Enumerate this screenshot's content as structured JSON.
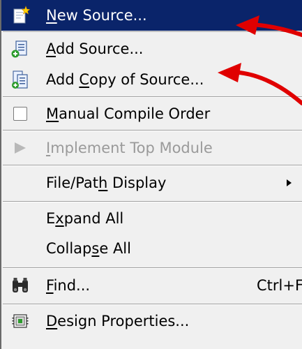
{
  "menu": {
    "items": [
      {
        "pre": "",
        "acc": "N",
        "post": "ew Source...",
        "icon": "new-source-icon",
        "state": "highlighted",
        "shortcut": ""
      },
      {
        "pre": "",
        "acc": "A",
        "post": "dd Source...",
        "icon": "add-source-icon",
        "state": "normal",
        "shortcut": ""
      },
      {
        "pre": "Add ",
        "acc": "C",
        "post": "opy of Source...",
        "icon": "add-copy-of-source-icon",
        "state": "normal",
        "shortcut": ""
      },
      {
        "pre": "",
        "acc": "M",
        "post": "anual Compile Order",
        "icon": "checkbox-unchecked-icon",
        "state": "normal",
        "shortcut": ""
      },
      {
        "pre": "",
        "acc": "I",
        "post": "mplement Top Module",
        "icon": "play-triangle-icon",
        "state": "disabled",
        "shortcut": ""
      },
      {
        "pre": "File/Pat",
        "acc": "h",
        "post": " Display",
        "icon": "",
        "state": "normal",
        "shortcut": ""
      },
      {
        "pre": "E",
        "acc": "x",
        "post": "pand All",
        "icon": "",
        "state": "normal",
        "shortcut": ""
      },
      {
        "pre": "Collap",
        "acc": "s",
        "post": "e All",
        "icon": "",
        "state": "normal",
        "shortcut": ""
      },
      {
        "pre": "",
        "acc": "F",
        "post": "ind...",
        "icon": "binoculars-icon",
        "state": "normal",
        "shortcut": "Ctrl+F"
      },
      {
        "pre": "",
        "acc": "D",
        "post": "esign Properties...",
        "icon": "design-properties-icon",
        "state": "normal",
        "shortcut": ""
      }
    ]
  },
  "colors": {
    "highlight": "#0a246a",
    "annotation_arrow": "#e00000",
    "disabled_text": "#9a9a9a",
    "menu_background": "#f0f0f0"
  }
}
